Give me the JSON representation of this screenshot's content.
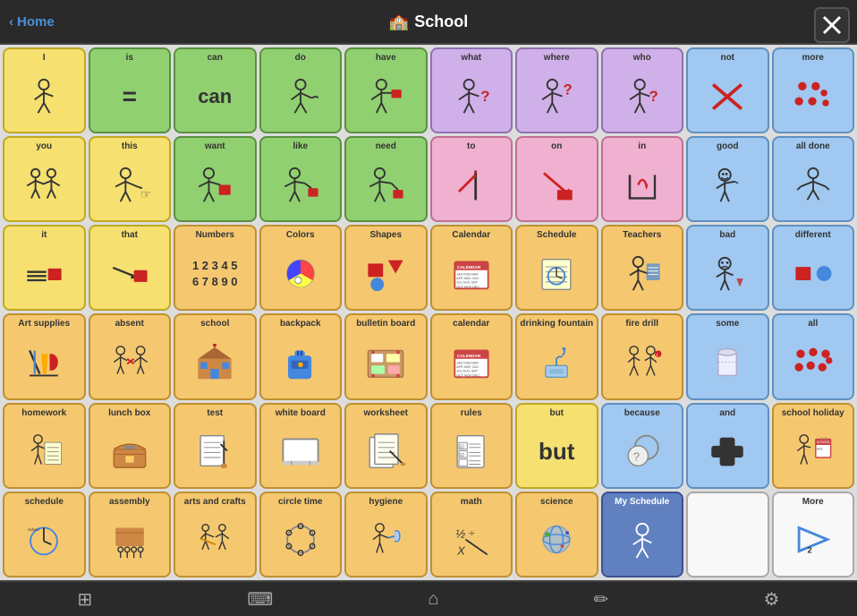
{
  "app": {
    "title": "School",
    "home_label": "Home",
    "close_label": "Close"
  },
  "bottom_bar": {
    "grid_icon": "⊞",
    "keyboard_icon": "⌨",
    "home_icon": "⌂",
    "pencil_icon": "✎",
    "settings_icon": "⚙"
  },
  "rows": [
    [
      {
        "label": "I",
        "color": "yellow",
        "icon": "👤"
      },
      {
        "label": "is",
        "color": "green",
        "icon": "═"
      },
      {
        "label": "can",
        "color": "green",
        "icon": "can_text"
      },
      {
        "label": "do",
        "color": "green",
        "icon": "👤➡"
      },
      {
        "label": "have",
        "color": "green",
        "icon": "👤📦"
      },
      {
        "label": "what",
        "color": "purple",
        "icon": "👤❓"
      },
      {
        "label": "where",
        "color": "purple",
        "icon": "👤❓"
      },
      {
        "label": "who",
        "color": "purple",
        "icon": "👤❓"
      },
      {
        "label": "not",
        "color": "blue",
        "icon": "✗"
      },
      {
        "label": "more",
        "color": "blue",
        "icon": "🔴🔴"
      }
    ],
    [
      {
        "label": "you",
        "color": "yellow",
        "icon": "👥"
      },
      {
        "label": "this",
        "color": "yellow",
        "icon": "👤➡"
      },
      {
        "label": "want",
        "color": "green",
        "icon": "👤🔲"
      },
      {
        "label": "like",
        "color": "green",
        "icon": "👤🔲"
      },
      {
        "label": "need",
        "color": "green",
        "icon": "👤➡🔲"
      },
      {
        "label": "to",
        "color": "pink",
        "icon": "↗|"
      },
      {
        "label": "on",
        "color": "pink",
        "icon": "↘🔲"
      },
      {
        "label": "in",
        "color": "pink",
        "icon": "↙⬜"
      },
      {
        "label": "good",
        "color": "blue",
        "icon": "😊👍"
      },
      {
        "label": "all done",
        "color": "blue",
        "icon": "👤👐"
      }
    ],
    [
      {
        "label": "it",
        "color": "yellow",
        "icon": "✋🔲"
      },
      {
        "label": "that",
        "color": "yellow",
        "icon": "👆🔲"
      },
      {
        "label": "Numbers",
        "color": "orange",
        "icon": "1234\n5\n6789 0"
      },
      {
        "label": "Colors",
        "color": "orange",
        "icon": "🎨"
      },
      {
        "label": "Shapes",
        "color": "orange",
        "icon": "🔺⬛🔵"
      },
      {
        "label": "Calendar",
        "color": "orange",
        "icon": "📅"
      },
      {
        "label": "Schedule",
        "color": "orange",
        "icon": "📋"
      },
      {
        "label": "Teachers",
        "color": "orange",
        "icon": "👩‍🏫"
      },
      {
        "label": "bad",
        "color": "blue",
        "icon": "😞🗑"
      },
      {
        "label": "different",
        "color": "blue",
        "icon": "🔲🔵"
      }
    ],
    [
      {
        "label": "Art supplies",
        "color": "orange",
        "icon": "✂🎨"
      },
      {
        "label": "absent",
        "color": "orange",
        "icon": "👤⬇👥"
      },
      {
        "label": "school",
        "color": "orange",
        "icon": "🏫"
      },
      {
        "label": "backpack",
        "color": "orange",
        "icon": "🎒"
      },
      {
        "label": "bulletin board",
        "color": "orange",
        "icon": "📌🗂"
      },
      {
        "label": "calendar",
        "color": "orange",
        "icon": "📅"
      },
      {
        "label": "drinking fountain",
        "color": "orange",
        "icon": "🚰"
      },
      {
        "label": "fire drill",
        "color": "orange",
        "icon": "🚶🚶"
      },
      {
        "label": "some",
        "color": "blue",
        "icon": "🥛"
      },
      {
        "label": "all",
        "color": "blue",
        "icon": "🔴🔴🔴"
      }
    ],
    [
      {
        "label": "homework",
        "color": "orange",
        "icon": "👤📋"
      },
      {
        "label": "lunch box",
        "color": "orange",
        "icon": "🧺"
      },
      {
        "label": "test",
        "color": "orange",
        "icon": "✏📄"
      },
      {
        "label": "white board",
        "color": "orange",
        "icon": "⬜"
      },
      {
        "label": "worksheet",
        "color": "orange",
        "icon": "📄✏"
      },
      {
        "label": "rules",
        "color": "orange",
        "icon": "☑️\n1\n2\n3"
      },
      {
        "label": "but",
        "color": "yellow",
        "icon": "but_text"
      },
      {
        "label": "because",
        "color": "blue",
        "icon": "💬❓"
      },
      {
        "label": "and",
        "color": "blue",
        "icon": "➕"
      },
      {
        "label": "school holiday",
        "color": "orange",
        "icon": "👤📅"
      }
    ],
    [
      {
        "label": "schedule",
        "color": "orange",
        "icon": "🕐📋"
      },
      {
        "label": "assembly",
        "color": "orange",
        "icon": "🎭👥"
      },
      {
        "label": "arts and crafts",
        "color": "orange",
        "icon": "🖌👥"
      },
      {
        "label": "circle time",
        "color": "orange",
        "icon": "👥⬤"
      },
      {
        "label": "hygiene",
        "color": "orange",
        "icon": "🚿✋"
      },
      {
        "label": "math",
        "color": "orange",
        "icon": "½÷\nX"
      },
      {
        "label": "science",
        "color": "orange",
        "icon": "🌍🔬"
      },
      {
        "label": "My Schedule",
        "color": "dark-blue",
        "icon": "👤📋"
      },
      {
        "label": "",
        "color": "white-bg",
        "icon": ""
      },
      {
        "label": "More",
        "color": "white-bg",
        "icon": "➡2"
      }
    ]
  ]
}
